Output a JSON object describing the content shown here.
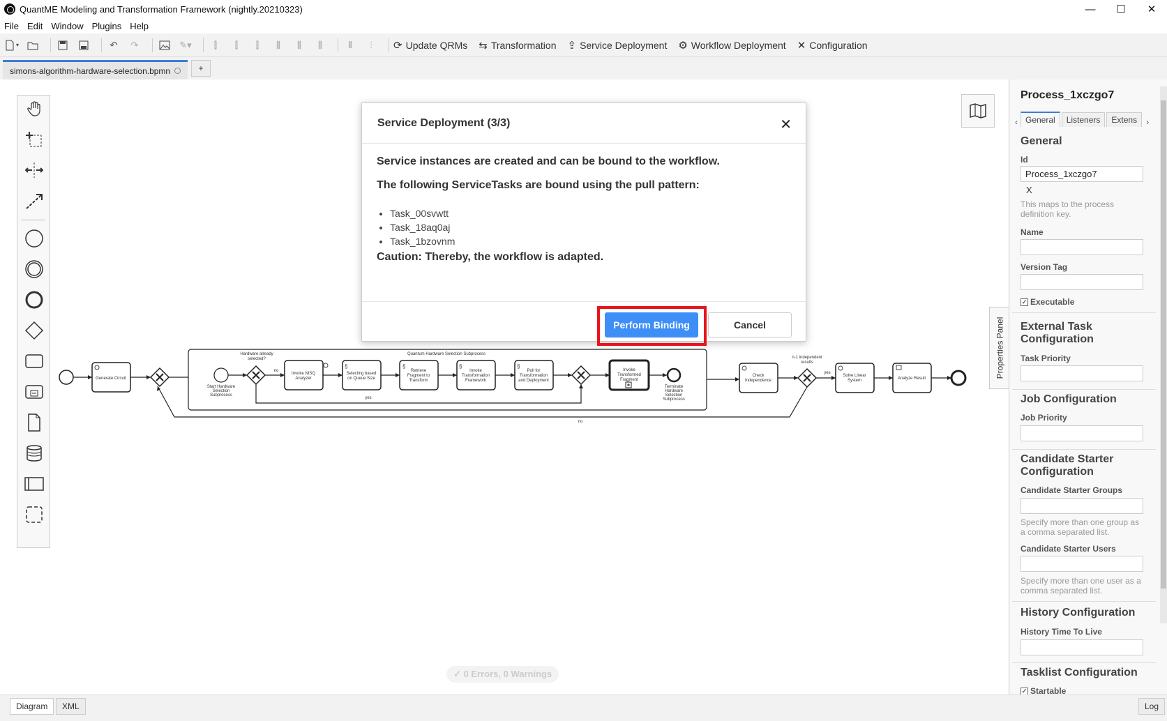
{
  "window": {
    "title": "QuantME Modeling and Transformation Framework (nightly.20210323)",
    "minimize": "—",
    "maximize": "☐",
    "close": "✕"
  },
  "menu": [
    "File",
    "Edit",
    "Window",
    "Plugins",
    "Help"
  ],
  "toolbar": {
    "update_qrms": "Update QRMs",
    "transformation": "Transformation",
    "service_deployment": "Service Deployment",
    "workflow_deployment": "Workflow Deployment",
    "configuration": "Configuration"
  },
  "tabs": {
    "file": "simons-algorithm-hardware-selection.bpmn",
    "add": "+"
  },
  "modal": {
    "title": "Service Deployment (3/3)",
    "line1": "Service instances are created and can be bound to the workflow.",
    "line2": "The following ServiceTasks are bound using the pull pattern:",
    "tasks": [
      "Task_00svwtt",
      "Task_18aq0aj",
      "Task_1bzovnm"
    ],
    "caution": "Caution: Thereby, the workflow is adapted.",
    "primary": "Perform Binding",
    "cancel": "Cancel",
    "highlight_color": "#e8141c"
  },
  "diagram": {
    "generate_circuit": "Generate Circuit",
    "subprocess_title": "Quantum Hardware Selection Subprocess",
    "hw_selected_1": "Hardware already",
    "hw_selected_2": "selected?",
    "start_1": "Start Hardware",
    "start_2": "Selection",
    "start_3": "Subprocess",
    "no": "no",
    "yes": "yes",
    "nisq_1": "Invoke NISQ",
    "nisq_2": "Analyzer",
    "queue_1": "Selecting based",
    "queue_2": "on Queue Size",
    "retrieve_1": "Retrieve",
    "retrieve_2": "Fragment to",
    "retrieve_3": "Transform",
    "invoke_tf_1": "Invoke",
    "invoke_tf_2": "Transformation",
    "invoke_tf_3": "Framework",
    "poll_1": "Poll for",
    "poll_2": "Transformation",
    "poll_3": "and Deployment",
    "inv_frag_1": "Invoke",
    "inv_frag_2": "Transformed",
    "inv_frag_3": "Fragment",
    "term_1": "Terminate",
    "term_2": "Hardware",
    "term_3": "Selection",
    "term_4": "Subprocess",
    "check_1": "Check",
    "check_2": "Independence",
    "n1_1": "n-1 independent",
    "n1_2": "results",
    "solve_1": "Solve Linear",
    "solve_2": "System",
    "analyze": "Analyze Result"
  },
  "status": "0 Errors, 0 Warnings",
  "properties": {
    "toggle": "Properties Panel",
    "title": "Process_1xczgo7",
    "tabs": [
      "General",
      "Listeners",
      "Extens"
    ],
    "general": "General",
    "id_label": "Id",
    "id_value": "Process_1xczgo7",
    "id_clear": "X",
    "id_hint": "This maps to the process definition key.",
    "name_label": "Name",
    "version_label": "Version Tag",
    "executable": "Executable",
    "ext_task": "External Task Configuration",
    "task_priority": "Task Priority",
    "job_config": "Job Configuration",
    "job_priority": "Job Priority",
    "cand_config": "Candidate Starter Configuration",
    "cand_groups": "Candidate Starter Groups",
    "cand_groups_hint": "Specify more than one group as a comma separated list.",
    "cand_users": "Candidate Starter Users",
    "cand_users_hint": "Specify more than one user as a comma separated list.",
    "history": "History Configuration",
    "history_ttl": "History Time To Live",
    "tasklist": "Tasklist Configuration",
    "startable": "Startable"
  },
  "bottom": {
    "diagram": "Diagram",
    "xml": "XML",
    "log": "Log"
  }
}
